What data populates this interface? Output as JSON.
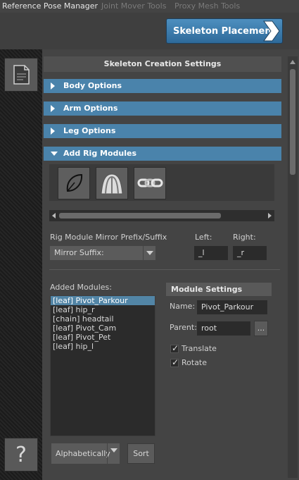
{
  "tabs": [
    {
      "label": "Reference Pose Manager",
      "active": true
    },
    {
      "label": "Joint Mover Tools",
      "active": false
    },
    {
      "label": "Proxy Mesh Tools",
      "active": false
    }
  ],
  "header": {
    "skeleton_button": "Skeleton Placement"
  },
  "sidebar": {
    "doc_icon": "document-icon",
    "help_label": "?"
  },
  "panel": {
    "title": "Skeleton Creation Settings",
    "frames": {
      "body": "Body Options",
      "arm": "Arm Options",
      "leg": "Leg Options",
      "rig": "Add Rig Modules"
    },
    "module_icons": [
      "leaf-icon",
      "jiggle-icon",
      "chain-icon"
    ],
    "mirror": {
      "label": "Rig Module Mirror Prefix/Suffix",
      "left_label": "Left:",
      "right_label": "Right:",
      "mode": "Mirror Suffix:",
      "left_value": "_l",
      "right_value": "_r"
    },
    "added_modules": {
      "label": "Added Modules:",
      "items": [
        "[leaf] Pivot_Parkour",
        "[leaf] hip_r",
        "[chain] headtail",
        "[leaf] Pivot_Cam",
        "[leaf] Pivot_Pet",
        "[leaf] hip_l"
      ],
      "selected_index": 0
    },
    "module_settings": {
      "header": "Module Settings",
      "name_label": "Name:",
      "name_value": "Pivot_Parkour",
      "parent_label": "Parent:",
      "parent_value": "root",
      "browse_label": "...",
      "translate_label": "Translate",
      "translate_checked": true,
      "rotate_label": "Rotate",
      "rotate_checked": true
    },
    "sort": {
      "mode": "Alphabetically",
      "button": "Sort"
    }
  },
  "colors": {
    "accent": "#4a83ab",
    "selection": "#5285a6"
  }
}
